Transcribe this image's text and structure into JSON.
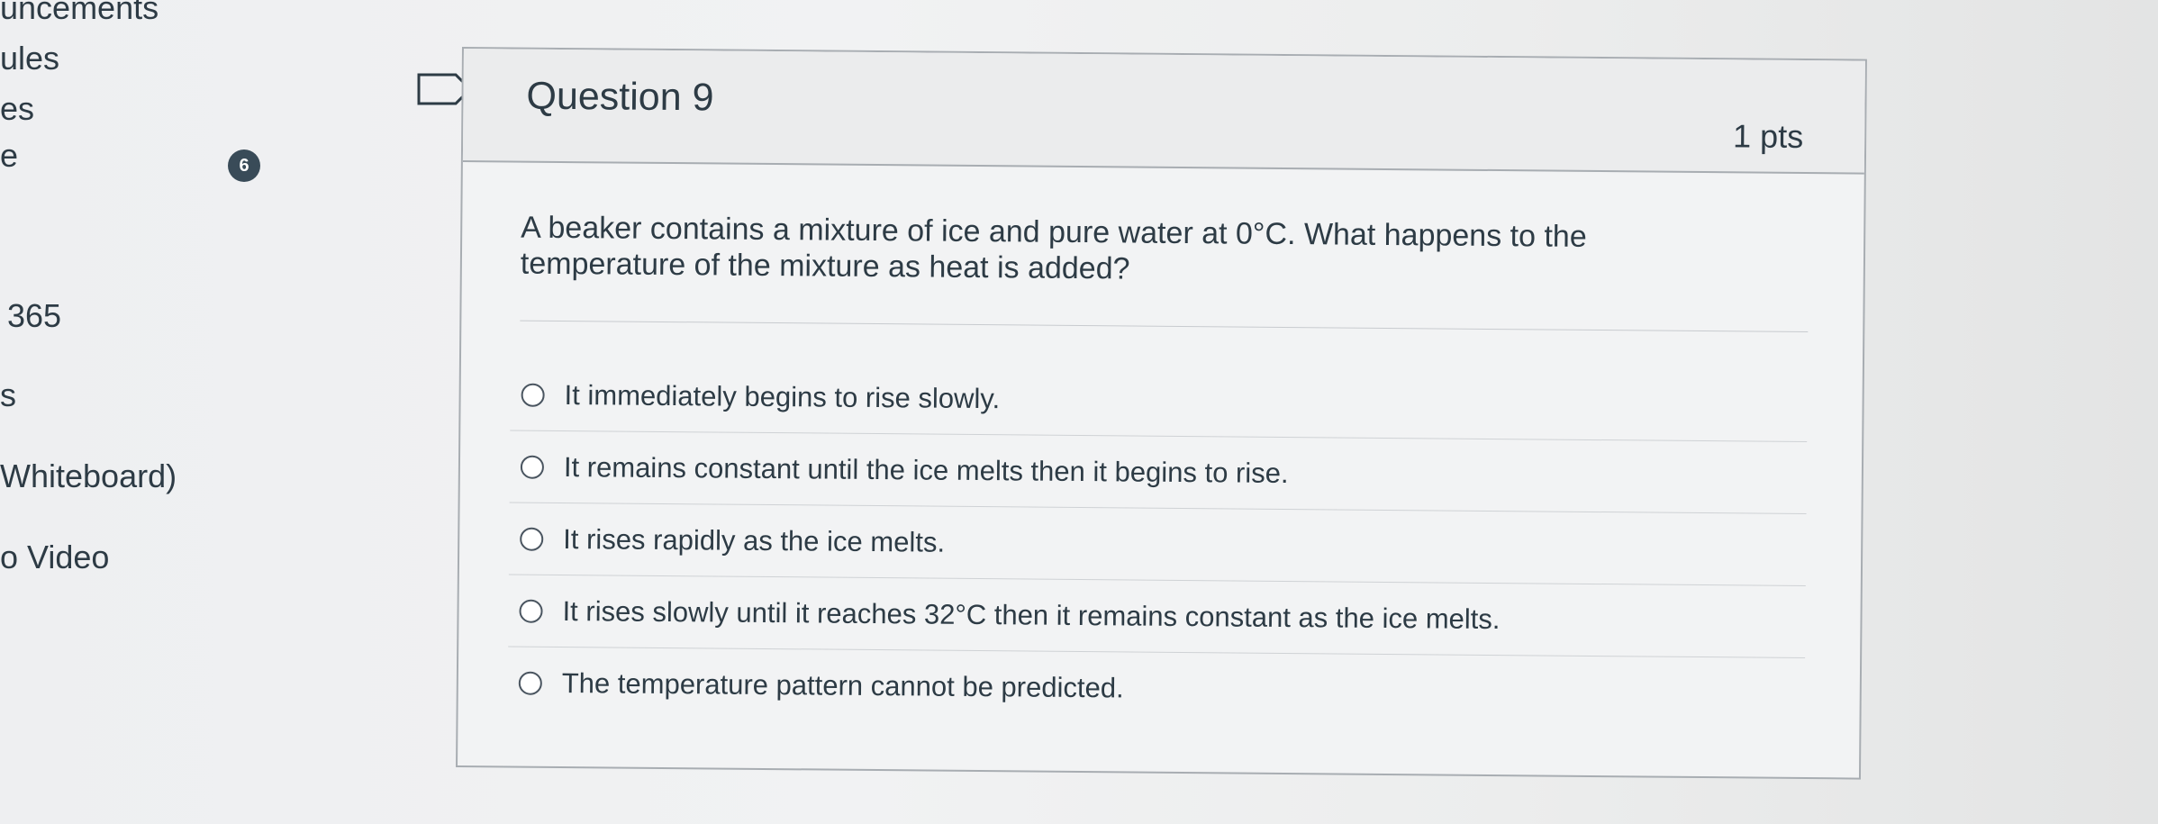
{
  "course_nav": {
    "items": [
      {
        "label": "uncements"
      },
      {
        "label": "ules"
      },
      {
        "label": "es",
        "badge": "6"
      },
      {
        "label": "e"
      },
      {
        "label": "365"
      },
      {
        "label": "s"
      },
      {
        "label": "Whiteboard)"
      },
      {
        "label": "o Video"
      }
    ]
  },
  "question": {
    "title": "Question 9",
    "points": "1 pts",
    "text": "A beaker contains a mixture of ice and pure water at 0°C. What happens to the temperature of the mixture as heat is added?",
    "answers": [
      {
        "label": "It immediately begins to rise slowly.",
        "selected": false
      },
      {
        "label": "It remains constant until the ice melts then it begins to rise.",
        "selected": false
      },
      {
        "label": "It rises rapidly as the ice melts.",
        "selected": false
      },
      {
        "label": "It rises slowly until it reaches 32°C then it remains constant as the ice melts.",
        "selected": false
      },
      {
        "label": "The temperature pattern cannot be predicted.",
        "selected": false
      }
    ]
  },
  "icons": {
    "flag": "flag-question-icon",
    "radio": "radio-unselected-icon"
  },
  "colors": {
    "text": "#2d3b45",
    "badge": "#394b58",
    "border": "#a8adb2",
    "card_background": "#f2f3f4"
  }
}
